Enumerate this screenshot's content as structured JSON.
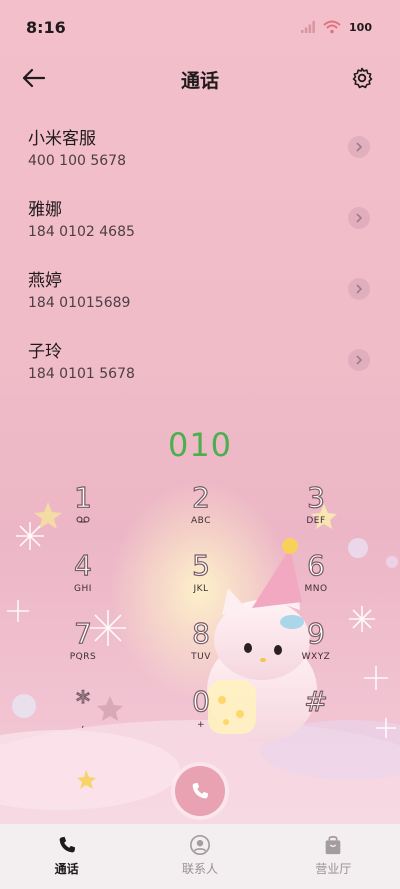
{
  "status": {
    "time": "8:16",
    "battery": "100"
  },
  "header": {
    "title": "通话"
  },
  "contacts": [
    {
      "name": "小米客服",
      "number": "400 100 5678"
    },
    {
      "name": "雅娜",
      "number": "184 0102 4685"
    },
    {
      "name": "燕婷",
      "number": "184 01015689"
    },
    {
      "name": "子玲",
      "number": "184 0101 5678"
    }
  ],
  "dialed_number": "010",
  "keypad": [
    {
      "digit": "1",
      "letters": ""
    },
    {
      "digit": "2",
      "letters": "ABC"
    },
    {
      "digit": "3",
      "letters": "DEF"
    },
    {
      "digit": "4",
      "letters": "GHI"
    },
    {
      "digit": "5",
      "letters": "JKL"
    },
    {
      "digit": "6",
      "letters": "MNO"
    },
    {
      "digit": "7",
      "letters": "PQRS"
    },
    {
      "digit": "8",
      "letters": "TUV"
    },
    {
      "digit": "9",
      "letters": "WXYZ"
    },
    {
      "digit": "*",
      "letters": ","
    },
    {
      "digit": "0",
      "letters": "+"
    },
    {
      "digit": "#",
      "letters": ""
    }
  ],
  "tabs": [
    {
      "label": "通话",
      "icon": "phone-icon",
      "active": true
    },
    {
      "label": "联系人",
      "icon": "person-icon",
      "active": false
    },
    {
      "label": "营业厅",
      "icon": "bag-icon",
      "active": false
    }
  ],
  "colors": {
    "accent_green": "#4cae4f",
    "call_button": "#e8a2b1"
  }
}
